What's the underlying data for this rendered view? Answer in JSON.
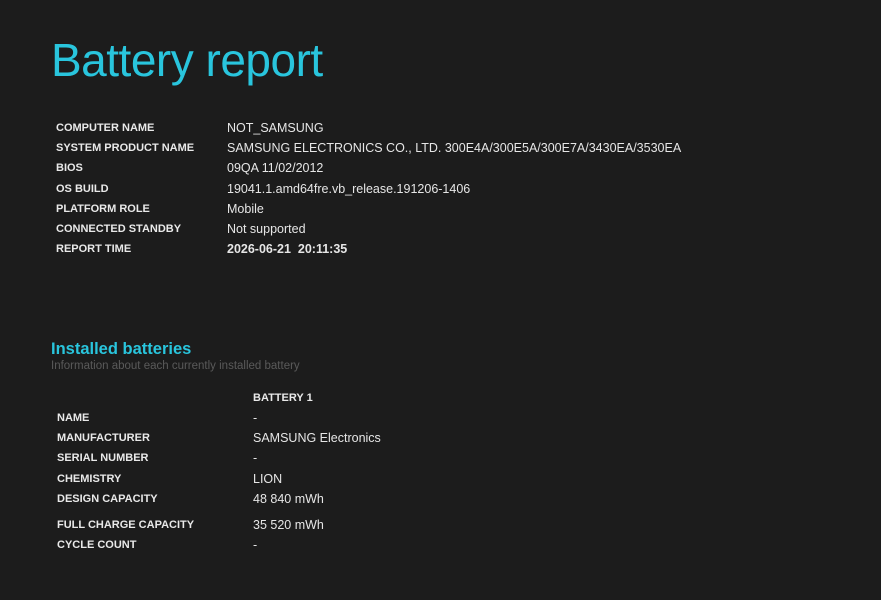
{
  "title": "Battery report",
  "system_info": [
    {
      "label": "COMPUTER NAME",
      "value": "NOT_SAMSUNG"
    },
    {
      "label": "SYSTEM PRODUCT NAME",
      "value": "SAMSUNG ELECTRONICS CO., LTD. 300E4A/300E5A/300E7A/3430EA/3530EA"
    },
    {
      "label": "BIOS",
      "value": "09QA 11/02/2012"
    },
    {
      "label": "OS BUILD",
      "value": "19041.1.amd64fre.vb_release.191206-1406"
    },
    {
      "label": "PLATFORM ROLE",
      "value": "Mobile"
    },
    {
      "label": "CONNECTED STANDBY",
      "value": "Not supported"
    },
    {
      "label": "REPORT TIME",
      "value": "2026-06-21  20:11:35"
    }
  ],
  "installed_batteries": {
    "heading": "Installed batteries",
    "subtitle": "Information about each currently installed battery",
    "column_header": "BATTERY 1",
    "rows": [
      {
        "label": "NAME",
        "value": "-"
      },
      {
        "label": "MANUFACTURER",
        "value": "SAMSUNG Electronics"
      },
      {
        "label": "SERIAL NUMBER",
        "value": "-"
      },
      {
        "label": "CHEMISTRY",
        "value": "LION"
      },
      {
        "label": "DESIGN CAPACITY",
        "value": "48 840 mWh"
      },
      {
        "label": "FULL CHARGE CAPACITY",
        "value": "35 520 mWh"
      },
      {
        "label": "CYCLE COUNT",
        "value": "-"
      }
    ]
  }
}
